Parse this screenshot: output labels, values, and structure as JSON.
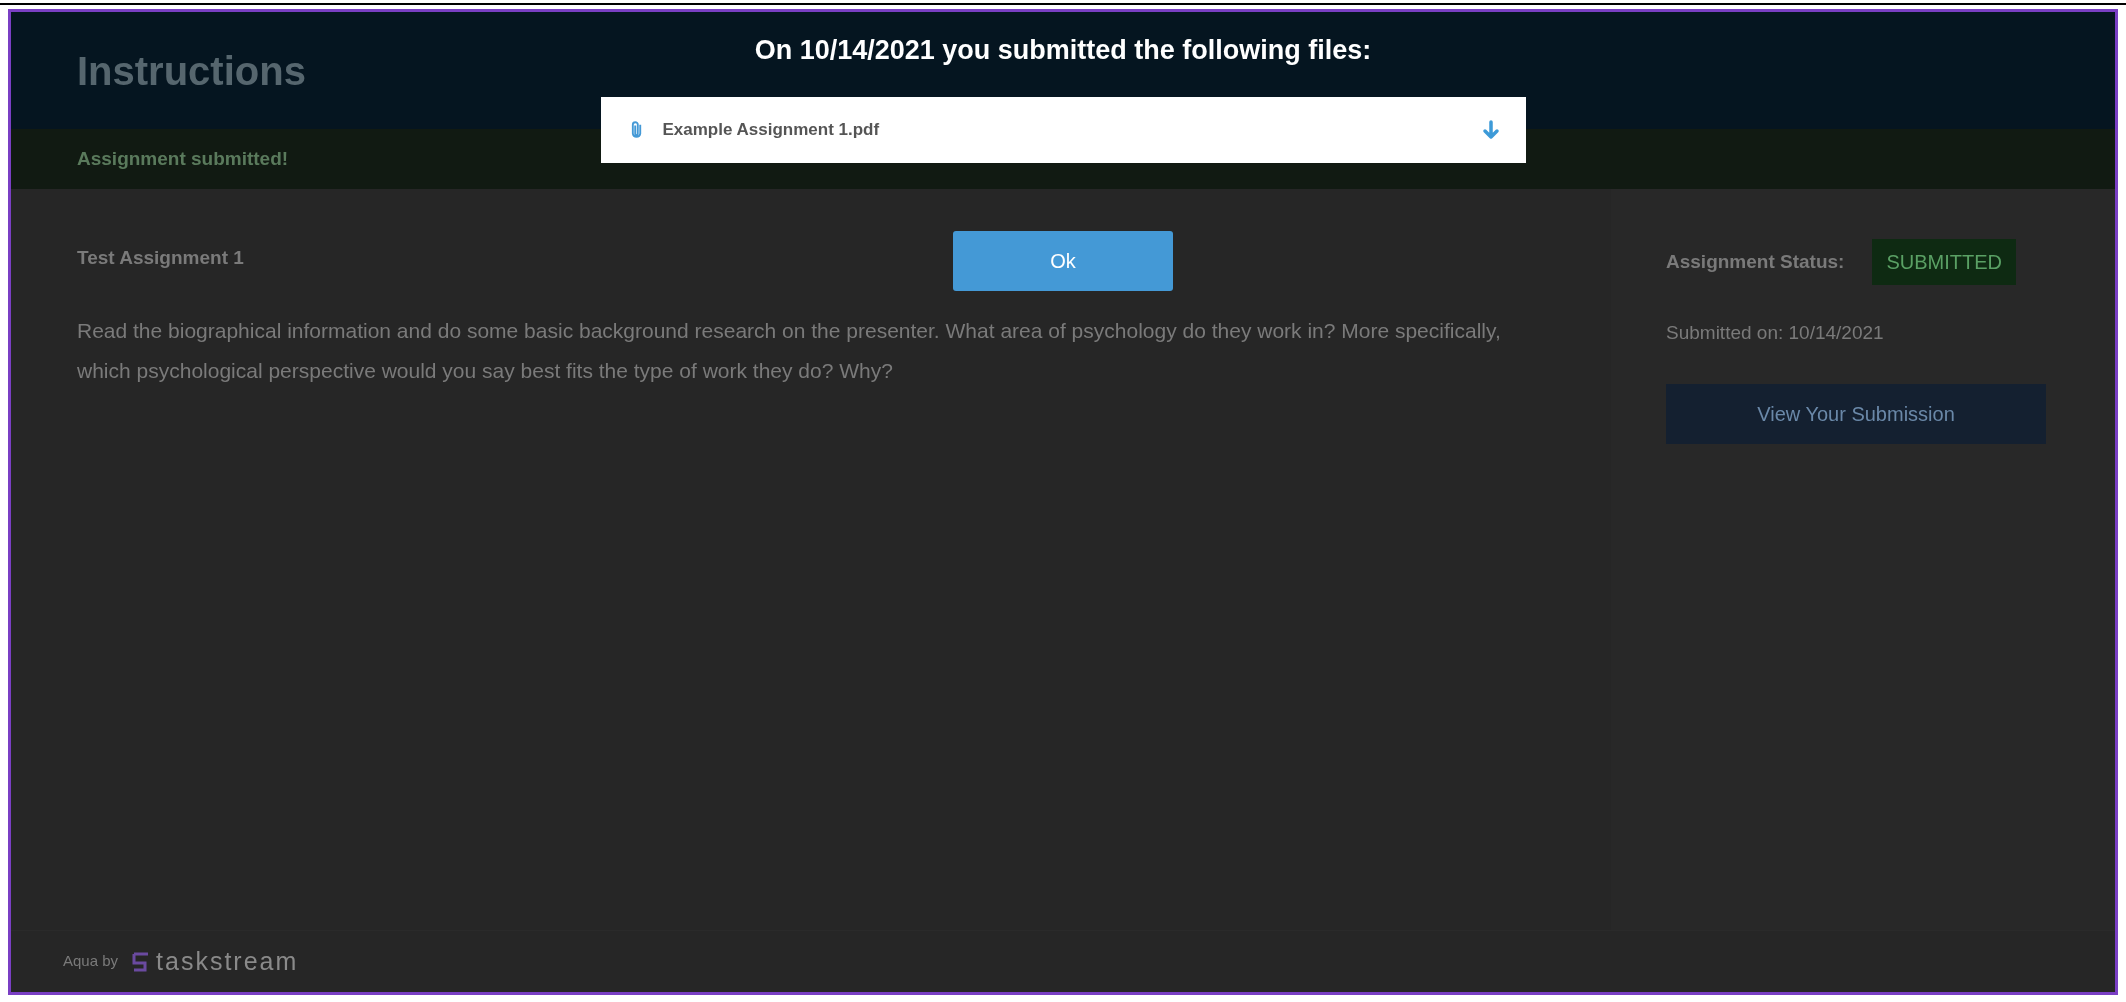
{
  "page": {
    "title": "Instructions",
    "banner": "Assignment submitted!",
    "assignment_title": "Test Assignment 1",
    "description": "Read the biographical information and do some basic background research on the presenter. What area of psychology do they work in? More specifically, which psychological perspective would you say best fits the type of work they do? Why?",
    "status_label": "Assignment Status:",
    "status": "SUBMITTED",
    "submitted_on": "Submitted on: 10/14/2021",
    "view_button": "View Your Submission"
  },
  "footer": {
    "prefix": "Aqua by",
    "brand": "taskstream"
  },
  "modal": {
    "title": "On 10/14/2021 you submitted the following files:",
    "files": [
      {
        "name": "Example Assignment 1.pdf"
      }
    ],
    "ok_button": "Ok"
  }
}
